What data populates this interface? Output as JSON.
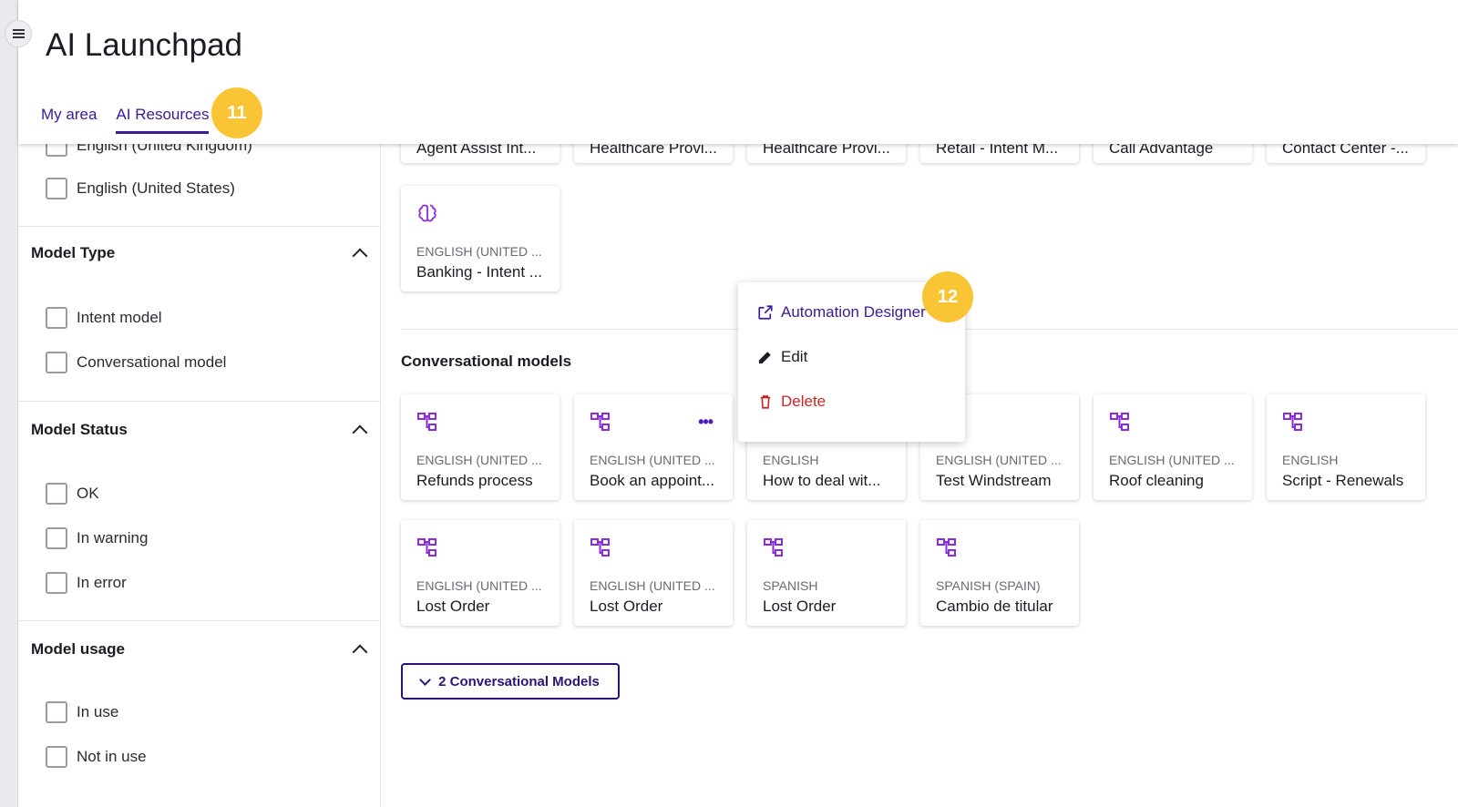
{
  "app": {
    "title": "AI Launchpad"
  },
  "tabs": [
    {
      "label": "My area",
      "active": false
    },
    {
      "label": "AI Resources",
      "active": true
    }
  ],
  "badges": {
    "tab_step": "11",
    "menu_step": "12"
  },
  "colors": {
    "accent": "#3d1a97",
    "badge": "#f9c534",
    "icon": "#8a2be2",
    "danger": "#c62828"
  },
  "sidebar": {
    "language_options": [
      "English (United Kingdom)",
      "English (United States)"
    ],
    "model_type": {
      "title": "Model Type",
      "options": [
        "Intent model",
        "Conversational model"
      ]
    },
    "model_status": {
      "title": "Model Status",
      "options": [
        "OK",
        "In warning",
        "In error"
      ]
    },
    "model_usage": {
      "title": "Model usage",
      "options": [
        "In use",
        "Not in use"
      ]
    }
  },
  "top_cards": [
    {
      "name": "Agent Assist Int..."
    },
    {
      "name": "Healthcare Provi..."
    },
    {
      "name": "Healthcare Provi..."
    },
    {
      "name": "Retail - Intent M..."
    },
    {
      "name": "Call Advantage"
    },
    {
      "name": "Contact Center -..."
    }
  ],
  "intent_cards": [
    {
      "icon": "brain-icon",
      "language": "English (United ...",
      "name": "Banking - Intent ..."
    }
  ],
  "conversational": {
    "title": "Conversational models",
    "cards": [
      {
        "icon": "flow-icon",
        "language": "English (United ...",
        "name": "Refunds process"
      },
      {
        "icon": "flow-icon",
        "language": "English (United ...",
        "name": "Book an appoint...",
        "has_menu": true
      },
      {
        "icon": "flow-icon",
        "language": "English",
        "name": "How to deal wit..."
      },
      {
        "icon": "flow-icon",
        "language": "English (United ...",
        "name": "Test Windstream"
      },
      {
        "icon": "flow-icon",
        "language": "English (United ...",
        "name": "Roof cleaning"
      },
      {
        "icon": "flow-icon",
        "language": "English",
        "name": "Script - Renewals"
      },
      {
        "icon": "flow-icon",
        "language": "English (United ...",
        "name": "Lost Order"
      },
      {
        "icon": "flow-icon",
        "language": "English (United ...",
        "name": "Lost Order"
      },
      {
        "icon": "flow-icon",
        "language": "Spanish",
        "name": "Lost Order"
      },
      {
        "icon": "flow-icon",
        "language": "Spanish (Spain)",
        "name": "Cambio de titular"
      }
    ],
    "more_button": "2 Conversational Models"
  },
  "context_menu": {
    "items": [
      {
        "label": "Automation Designer",
        "icon": "external-link-icon"
      },
      {
        "label": "Edit",
        "icon": "pencil-icon"
      },
      {
        "label": "Delete",
        "icon": "trash-icon"
      }
    ]
  }
}
